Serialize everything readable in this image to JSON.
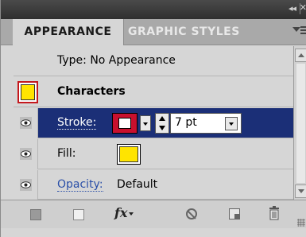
{
  "panel": {
    "tabs": [
      {
        "label": "APPEARANCE",
        "active": true
      },
      {
        "label": "GRAPHIC STYLES",
        "active": false
      }
    ],
    "collapse_glyph": "◂◂",
    "close_glyph": "✕"
  },
  "rows": {
    "type_label": "Type: No Appearance",
    "characters_label": "Characters",
    "stroke_label": "Stroke:",
    "stroke_weight": "7 pt",
    "fill_label": "Fill:",
    "opacity_label": "Opacity:",
    "opacity_value": "Default"
  },
  "colors": {
    "highlight_row": "#1b2f77",
    "stroke_swatch": "#c8102e",
    "fill_swatch": "#ffe400",
    "link_blue": "#2a4fa8"
  },
  "toolbar": {
    "fx_label": "fx"
  },
  "icons": [
    "eye-icon",
    "scroll-up-icon",
    "scroll-down-icon",
    "clear-appearance-icon",
    "duplicate-item-icon",
    "trash-icon",
    "panel-menu-icon"
  ]
}
